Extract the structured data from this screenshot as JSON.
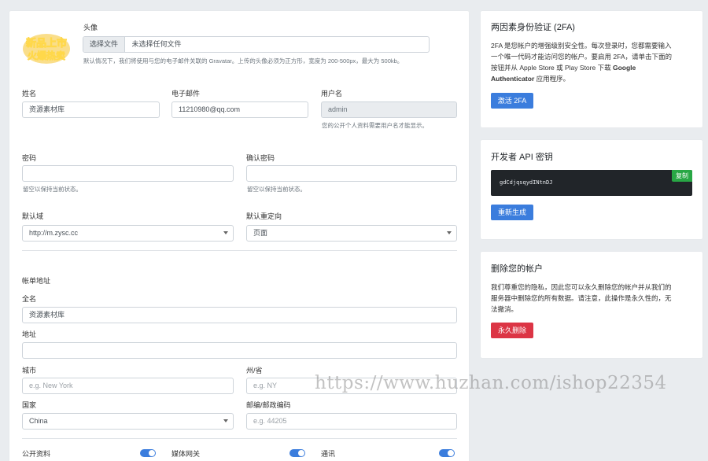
{
  "profile": {
    "avatar_label": "头像",
    "choose_file_label": "选择文件",
    "no_file_text": "未选择任何文件",
    "avatar_help": "默认情况下，我们将使用与您的电子邮件关联的 Gravatar。上传的头像必须为正方形，宽度为 200-500px，最大为 500kb。",
    "avatar_logo_text": "新品上市 火爆热卖"
  },
  "fields": {
    "name_label": "姓名",
    "name_value": "资源素材库",
    "email_label": "电子邮件",
    "email_value": "11210980@qq.com",
    "username_label": "用户名",
    "username_value": "admin",
    "username_help": "您的公开个人资料需要用户名才能显示。",
    "password_label": "密码",
    "password_help": "留空以保持当前状态。",
    "confirm_password_label": "确认密码",
    "confirm_password_help": "留空以保持当前状态。",
    "default_domain_label": "默认域",
    "default_domain_value": "http://m.zysc.cc",
    "default_redirect_label": "默认重定向",
    "default_redirect_value": "页面"
  },
  "billing": {
    "section_title": "帐单地址",
    "fullname_label": "全名",
    "fullname_value": "资源素材库",
    "address_label": "地址",
    "address_value": "",
    "city_label": "城市",
    "city_placeholder": "e.g. New York",
    "state_label": "州/省",
    "state_placeholder": "e.g. NY",
    "country_label": "国家",
    "country_value": "China",
    "zip_label": "邮编/邮政编码",
    "zip_placeholder": "e.g. 44205"
  },
  "toggles": {
    "public_profile_label": "公开资料",
    "public_profile_on": true,
    "media_gateway_label": "媒体网关",
    "media_gateway_on": true,
    "notifications_label": "通讯",
    "notifications_on": true
  },
  "twofa": {
    "title": "两因素身份验证 (2FA)",
    "text_1": "2FA 是您帐户的增强级别安全性。每次登录时，您都需要输入",
    "text_2": "一个唯一代码才能访问您的帐户。要启用 2FA，请单击下面的",
    "text_3": "按钮并从 Apple Store 或 Play Store 下载",
    "text_3_bold": "Google",
    "text_4_bold": "Authenticator",
    "text_4": "应用程序。",
    "button_label": "激活 2FA"
  },
  "api": {
    "title": "开发者 API 密钥",
    "key_value": "gdCdjqsqydINtnDJ",
    "copy_label": "复制",
    "regenerate_label": "重新生成"
  },
  "delete_account": {
    "title": "删除您的帐户",
    "text_1": "我们尊重您的隐私，因此您可以永久删除您的帐户并从我们的",
    "text_2": "服务器中删除您的所有数据。请注意，此操作是永久性的，无",
    "text_3": "法撤消。",
    "button_label": "永久删除"
  },
  "watermark": "https://www.huzhan.com/ishop22354",
  "colors": {
    "primary": "#3b7ddd",
    "danger": "#dc3545",
    "success": "#28a745",
    "dark": "#212529"
  }
}
